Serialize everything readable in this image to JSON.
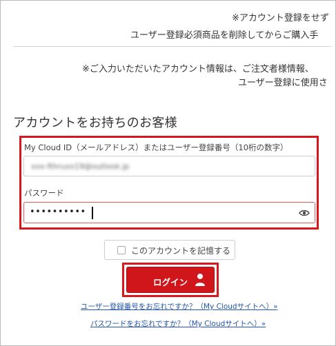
{
  "notices": {
    "line1": "※アカウント登録をせず",
    "line2": "ユーザー登録必須商品を削除してからご購入手",
    "line3": "※ご入力いただいたアカウント情報は、ご注文者様情報、",
    "line4": "ユーザー登録に使用さ"
  },
  "login_section": {
    "title": "アカウントをお持ちのお客様",
    "id_label": "My Cloud ID（メールアドレス）またはユーザー登録番号（10桁の数字）",
    "id_value": "xxx-fthruxx19@outlook.jp",
    "password_label": "パスワード",
    "password_value": "••••••••••",
    "remember_label": "このアカウントを記憶する",
    "login_label": "ログイン"
  },
  "links": {
    "forgot_user_number": "ユーザー登録番号をお忘れですか？（My Cloudサイトへ）»",
    "forgot_password": "パスワードをお忘れですか？（My Cloudサイトへ）»"
  },
  "colors": {
    "accent": "#d0151b",
    "highlight": "#d9161b",
    "link": "#2255aa"
  }
}
